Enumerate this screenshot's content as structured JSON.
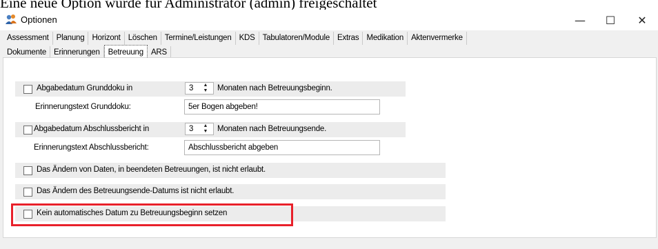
{
  "caption": "Eine neue Option wurde für Administrator (admin) freigeschaltet",
  "window": {
    "title": "Optionen",
    "app_icon": "users-icon",
    "minimize_icon": "minimize-icon",
    "maximize_icon": "maximize-icon",
    "close_icon": "close-icon",
    "minimize_glyph": "—",
    "maximize_glyph": "☐",
    "close_glyph": "✕"
  },
  "tabs": {
    "row1": [
      "Assessment",
      "Planung",
      "Horizont",
      "Löschen",
      "Termine/Leistungen",
      "KDS",
      "Tabulatoren/Module",
      "Extras",
      "Medikation",
      "Aktenvermerke"
    ],
    "row2": [
      "Dokumente",
      "Erinnerungen",
      "Betreuung",
      "ARS"
    ],
    "active": "Betreuung"
  },
  "betreuung": {
    "grunddoku": {
      "checkbox_label": "Abgabedatum Grunddoku in",
      "checked": false,
      "months_value": "3",
      "suffix": "Monaten nach Betreuungsbeginn.",
      "reminder_label": "Erinnerungstext Grunddoku:",
      "reminder_value": "5er Bogen abgeben!"
    },
    "abschluss": {
      "checkbox_label": "Abgabedatum Abschlussbericht in",
      "checked": false,
      "months_value": "3",
      "suffix": "Monaten nach Betreuungsende.",
      "reminder_label": "Erinnerungstext Abschlussbericht:",
      "reminder_value": "Abschlussbericht abgeben"
    },
    "option_no_edit_finished": {
      "label": "Das Ändern von Daten, in beendeten Betreuungen, ist nicht erlaubt.",
      "checked": false
    },
    "option_no_edit_enddate": {
      "label": "Das Ändern des Betreuungsende-Datums ist nicht erlaubt.",
      "checked": false
    },
    "option_no_auto_date": {
      "label": "Kein automatisches Datum zu Betreuungsbeginn setzen",
      "checked": false,
      "highlighted": true
    }
  },
  "spinner": {
    "up": "▲",
    "down": "▼"
  },
  "colors": {
    "highlight": "#e8202a",
    "panel": "#ffffff",
    "row_bg": "#ececec",
    "window_bg": "#f0f0f0"
  }
}
